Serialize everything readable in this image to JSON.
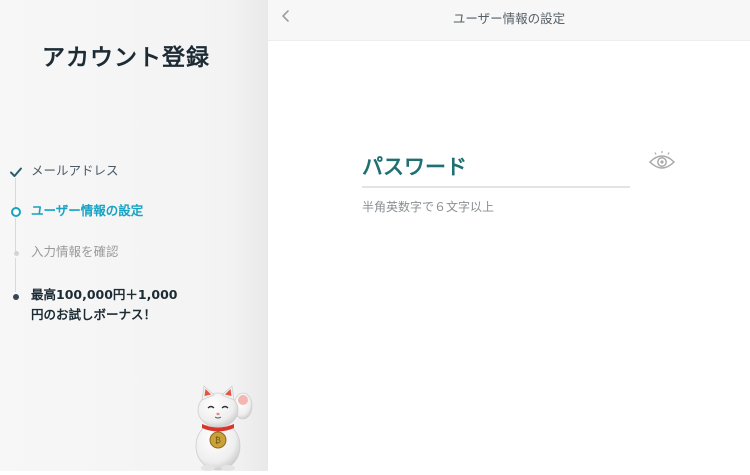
{
  "sidebar": {
    "title": "アカウント登録",
    "steps": [
      {
        "label": "メールアドレス",
        "state": "done"
      },
      {
        "label": "ユーザー情報の設定",
        "state": "current"
      },
      {
        "label": "入力情報を確認",
        "state": "todo"
      },
      {
        "label": "最高100,000円＋1,000円のお試しボーナス！",
        "state": "bonus"
      }
    ]
  },
  "header": {
    "title": "ユーザー情報の設定"
  },
  "form": {
    "password": {
      "placeholder": "パスワード",
      "value": "",
      "hint": "半角英数字で６文字以上"
    }
  },
  "icons": {
    "back": "chevron-left-icon",
    "done": "check-icon",
    "reveal": "eye-icon",
    "mascot": "lucky-cat-mascot"
  },
  "colors": {
    "accent": "#17a3c4",
    "title": "#1d2b35",
    "field_text": "#1f6f73",
    "sidebar_bg": "#f4f4f4"
  }
}
